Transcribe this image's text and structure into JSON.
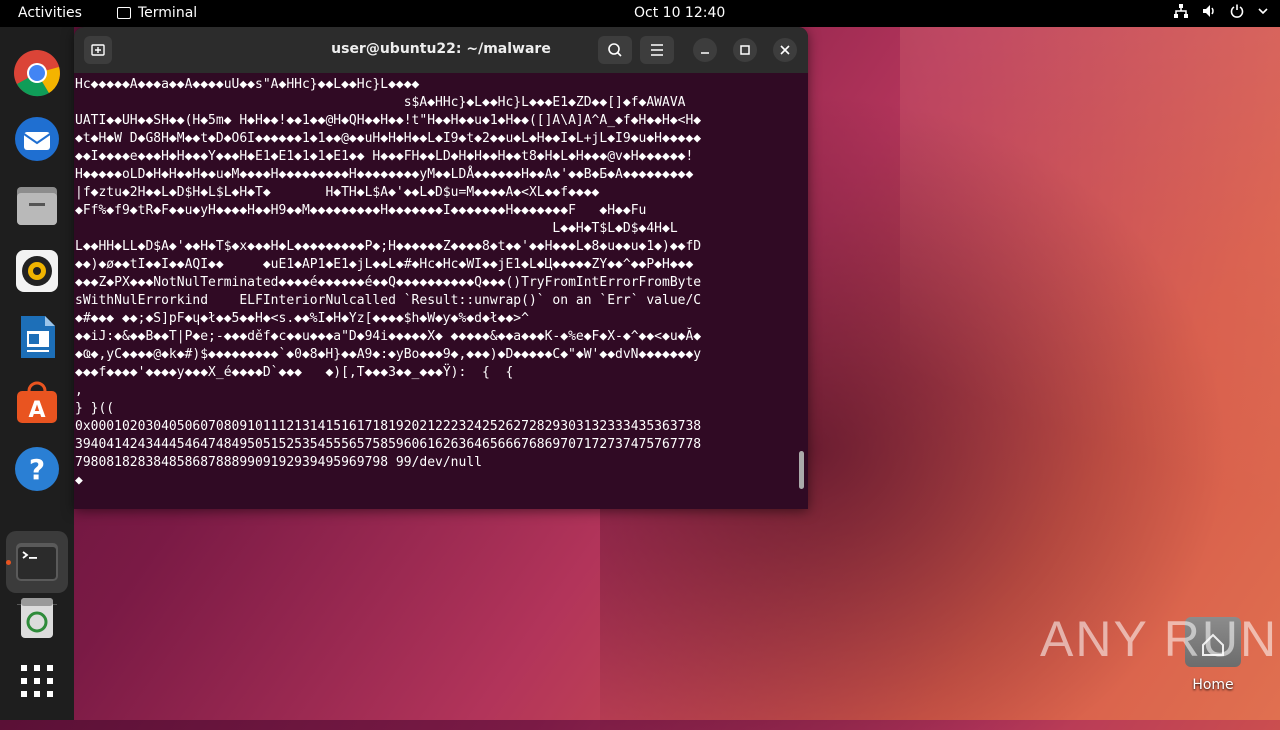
{
  "topbar": {
    "activities": "Activities",
    "app_name": "Terminal",
    "clock": "Oct 10  12:40"
  },
  "dock": {
    "items": [
      "chrome-icon",
      "thunderbird-icon",
      "files-icon",
      "rhythmbox-icon",
      "writer-icon",
      "app-center-icon",
      "help-icon",
      "terminal-icon",
      "trash-icon",
      "show-apps-icon"
    ]
  },
  "window": {
    "title": "user@ubuntu22: ~/malware",
    "terminal_lines": [
      "Hc◆◆◆◆◆A◆◆◆a◆◆A◆◆◆◆uU◆◆s\"A◆HHc}◆◆L◆◆Hc}L◆◆◆◆",
      "                                          s$A◆HHc}◆L◆◆Hc}L◆◆◆E1◆ZD◆◆[]◆f◆AWAVA",
      "UATI◆◆UH◆◆SH◆◆(H◆5m◆ H◆H◆◆!◆◆1◆◆@H◆QH◆◆H◆◆!t\"H◆◆H◆◆u◆1◆H◆◆([]A\\A]A^A_◆f◆H◆◆H◆<H◆",
      "◆t◆H◆W D◆G8H◆M◆◆t◆D◆O6I◆◆◆◆◆◆1◆1◆◆@◆◆uH◆H◆H◆◆L◆I9◆t◆2◆◆u◆L◆H◆◆I◆L+jL◆I9◆u◆H◆◆◆◆◆",
      "◆◆I◆◆◆◆e◆◆◆H◆H◆◆◆Y◆◆◆H◆E1◆E1◆1◆1◆E1◆◆ H◆◆◆FH◆◆LD◆H◆H◆◆H◆◆t8◆H◆L◆H◆◆◆@v◆H◆◆◆◆◆◆!",
      "H◆◆◆◆◆oLD◆H◆H◆◆H◆◆u◆M◆◆◆◆H◆◆◆◆◆◆◆◆◆H◆◆◆◆◆◆◆◆yM◆◆LDÅ◆◆◆◆◆◆H◆◆A◆'◆◆B◆Б◆A◆◆◆◆◆◆◆◆◆",
      "|f◆ztu◆2H◆◆L◆D$H◆L$L◆H◆T◆       H◆TH◆L$A◆'◆◆L◆D$u=M◆◆◆◆A◆<XL◆◆f◆◆◆◆",
      "◆Ff%◆f9◆tR◆F◆◆u◆yH◆◆◆◆H◆◆H9◆◆M◆◆◆◆◆◆◆◆◆H◆◆◆◆◆◆◆I◆◆◆◆◆◆◆H◆◆◆◆◆◆◆F   ◆H◆◆Fu",
      "                                                             L◆◆H◆T$L◆D$◆4H◆L",
      "L◆◆HH◆LL◆D$A◆'◆◆H◆T$◆x◆◆◆H◆L◆◆◆◆◆◆◆◆◆P◆;H◆◆◆◆◆◆Z◆◆◆◆8◆t◆◆'◆◆H◆◆◆L◆8◆u◆◆u◆1◆)◆◆fD",
      "◆◆)◆ø◆◆tI◆◆I◆◆AQI◆◆     ◆uE1◆AP1◆E1◆jL◆◆L◆#◆Hc◆Hc◆WI◆◆jE1◆L◆Ц◆◆◆◆◆ZY◆◆^◆◆P◆H◆◆◆",
      "◆◆◆Z◆PX◆◆◆NotNulTerminated◆◆◆◆é◆◆◆◆◆◆é◆◆Q◆◆◆◆◆◆◆◆◆◆Q◆◆◆()TryFromIntErrorFromByte",
      "sWithNulErrorkind    ELFInteriorNulcalled `Result::unwrap()` on an `Err` value/C",
      "◆#◆◆◆ ◆◆;◆S]pF◆ɥ◆ł◆◆5◆◆H◆<s.◆◆%I◆H◆Yz[◆◆◆◆$h◆W◆ƴ◆%◆d◆ł◆◆>^",
      "◆◆iJ:◆&◆◆B◆◆T|P◆e;-◆◆◆děf◆c◆◆u◆◆◆a\"D◆94i◆◆◆◆◆X◆ ◆◆◆◆◆&◆◆a◆◆◆K-◆%e◆F◆X-◆^◆◆<◆u◆Ă◆",
      "◆Ҩ◆,yC◆◆◆◆@◆k◆#)$◆◆◆◆◆◆◆◆◆`◆0◆8◆H}◆◆A9◆:◆yBo◆◆◆9◆,◆◆◆)◆D◆◆◆◆◆C◆\"◆W'◆◆dvN◆◆◆◆◆◆◆y",
      "◆◆◆f◆◆◆◆'◆◆◆◆y◆◆◆X_é◆◆◆◆D`◆◆◆   ◆)[,T◆◆◆3◆◆_◆◆◆Ÿ):  {  {",
      ",",
      "} }((",
      "0x000102030405060708091011121314151617181920212223242526272829303132333435363738",
      "39404142434445464748495051525354555657585960616263646566676869707172737475767778",
      "7980818283848586878889909192939495969798 99/dev/null",
      "◆"
    ]
  },
  "desktop": {
    "home_label": "Home",
    "watermark": "ANY RUN"
  },
  "colors": {
    "terminal_bg": "#300a24",
    "titlebar_bg": "#2c2c2c",
    "accent": "#e95420"
  }
}
